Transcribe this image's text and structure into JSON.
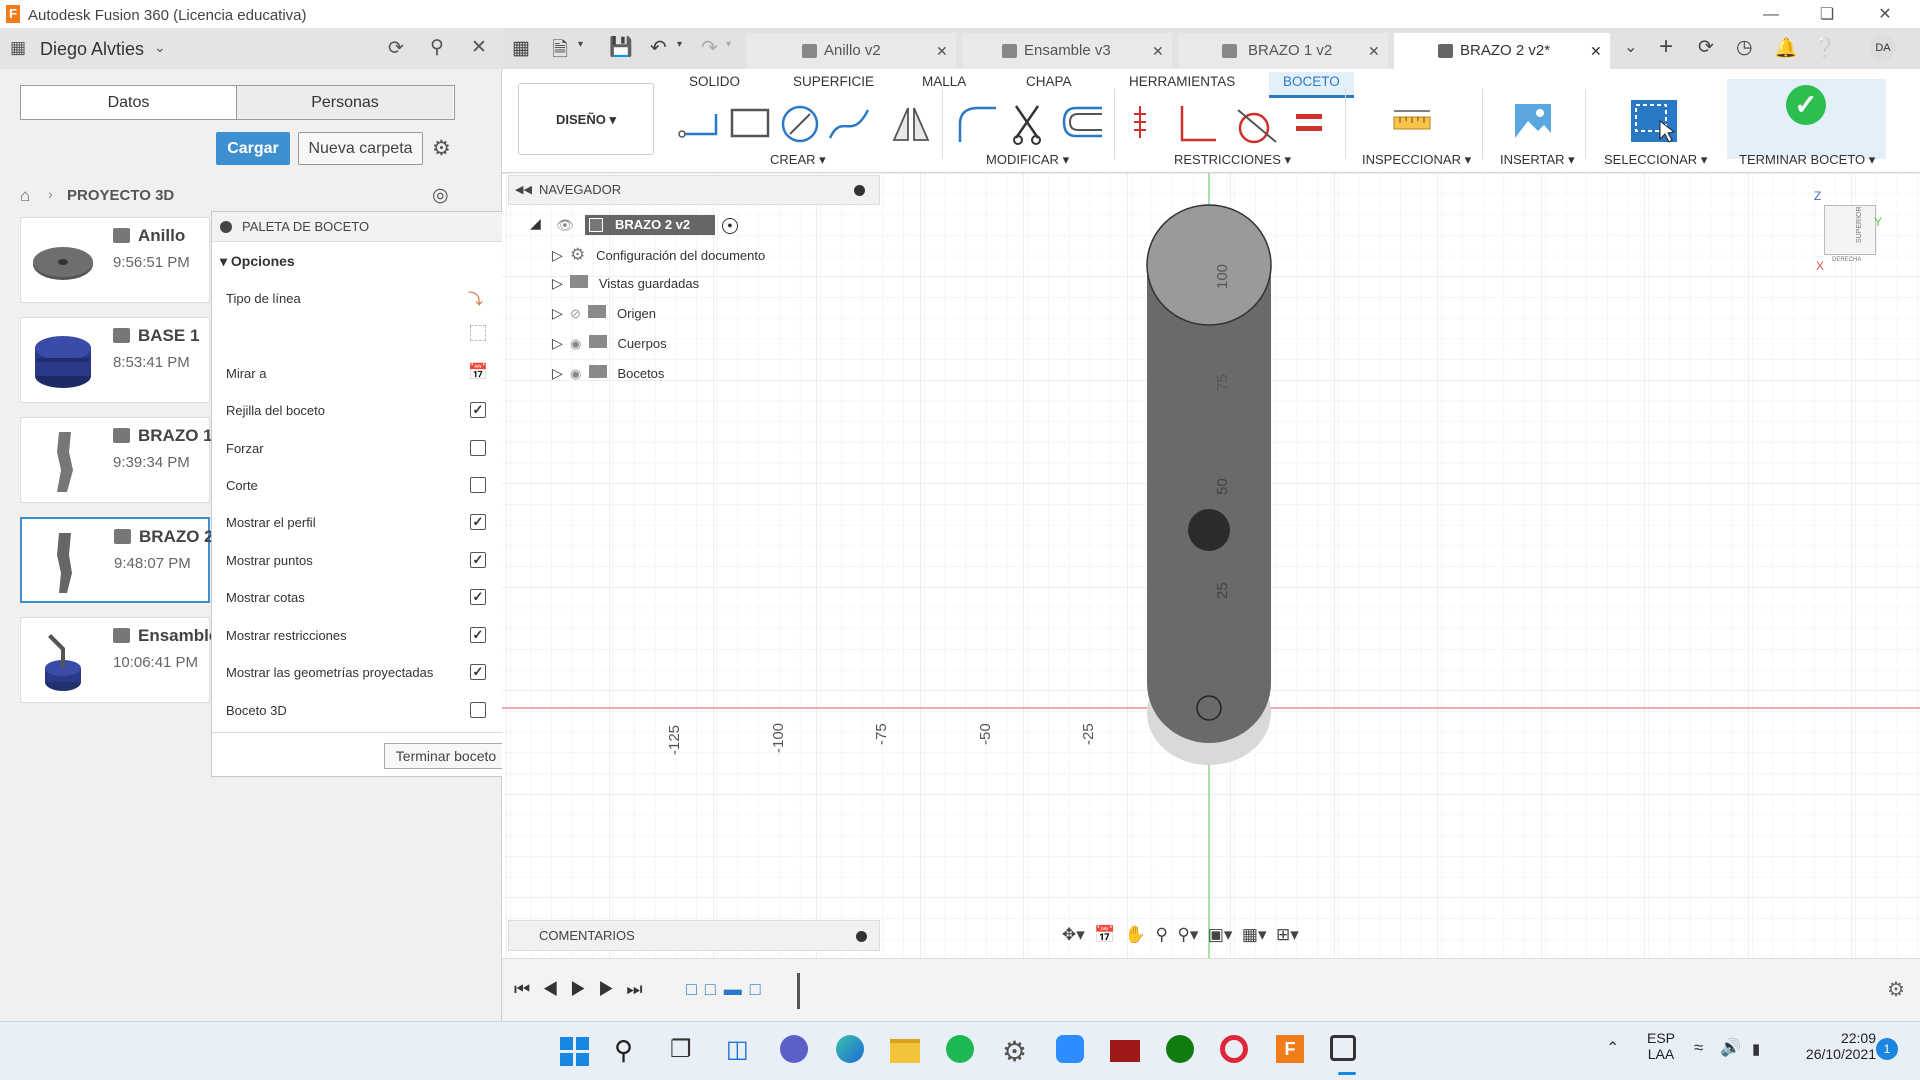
{
  "window": {
    "title": "Autodesk Fusion 360 (Licencia educativa)"
  },
  "left_panel": {
    "user": "Diego Alvties",
    "tabs": [
      "Datos",
      "Personas"
    ],
    "upload_label": "Cargar",
    "new_folder_label": "Nueva carpeta",
    "project": "PROYECTO 3D",
    "files": [
      {
        "name": "Anillo",
        "time": "9:56:51 PM"
      },
      {
        "name": "BASE 1",
        "time": "8:53:41 PM"
      },
      {
        "name": "BRAZO 1",
        "time": "9:39:34 PM"
      },
      {
        "name": "BRAZO 2",
        "time": "9:48:07 PM"
      },
      {
        "name": "Ensamble",
        "time": "10:06:41 PM"
      }
    ]
  },
  "palette": {
    "title": "PALETA DE BOCETO",
    "section": "Opciones",
    "rows": [
      {
        "label": "Tipo de línea",
        "checked": null
      },
      {
        "label": "Mirar a",
        "checked": null
      },
      {
        "label": "Rejilla del boceto",
        "checked": true
      },
      {
        "label": "Forzar",
        "checked": false
      },
      {
        "label": "Corte",
        "checked": false
      },
      {
        "label": "Mostrar el perfil",
        "checked": true
      },
      {
        "label": "Mostrar puntos",
        "checked": true
      },
      {
        "label": "Mostrar cotas",
        "checked": true
      },
      {
        "label": "Mostrar restricciones",
        "checked": true
      },
      {
        "label": "Mostrar las geometrías proyectadas",
        "checked": true
      },
      {
        "label": "Boceto 3D",
        "checked": false
      }
    ],
    "finish_label": "Terminar boceto"
  },
  "doc_tabs": [
    {
      "label": "Anillo v2",
      "active": false
    },
    {
      "label": "Ensamble v3",
      "active": false
    },
    {
      "label": "BRAZO 1 v2",
      "active": false
    },
    {
      "label": "BRAZO 2 v2*",
      "active": true
    }
  ],
  "toolbar": {
    "workspace": "DISEÑO",
    "tabs": [
      "SOLIDO",
      "SUPERFICIE",
      "MALLA",
      "CHAPA",
      "HERRAMIENTAS",
      "BOCETO"
    ],
    "active_tab": "BOCETO",
    "groups": [
      "CREAR",
      "MODIFICAR",
      "RESTRICCIONES",
      "INSPECCIONAR",
      "INSERTAR",
      "SELECCIONAR",
      "TERMINAR BOCETO"
    ]
  },
  "navigator": {
    "title": "NAVEGADOR",
    "root": "BRAZO 2 v2",
    "items": [
      "Configuración del documento",
      "Vistas guardadas",
      "Origen",
      "Cuerpos",
      "Bocetos"
    ]
  },
  "comments": {
    "title": "COMENTARIOS"
  },
  "viewport": {
    "x_ticks": [
      "-125",
      "-100",
      "-75",
      "-50",
      "-25"
    ],
    "y_ticks": [
      "100",
      "75",
      "50",
      "25"
    ],
    "viewcube": {
      "face": "SUPERIOR",
      "side": "DERECHA",
      "axes": [
        "Z",
        "Y",
        "X"
      ]
    }
  },
  "taskbar": {
    "lang": "ESP",
    "lang2": "LAA",
    "time": "22:09",
    "date": "26/10/2021",
    "notif": "1"
  },
  "colors": {
    "accent": "#2a79c6",
    "finish_green": "#2ebd4f"
  }
}
